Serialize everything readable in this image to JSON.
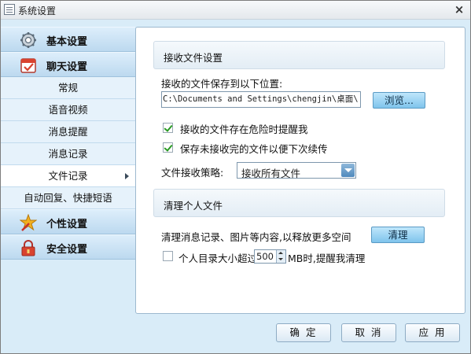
{
  "window": {
    "title": "系统设置",
    "close_glyph": "×"
  },
  "sidebar": {
    "main_items": [
      {
        "label": "基本设置",
        "icon": "gear-icon"
      },
      {
        "label": "聊天设置",
        "icon": "calendar-check-icon"
      },
      {
        "label": "个性设置",
        "icon": "star-brush-icon"
      },
      {
        "label": "安全设置",
        "icon": "lock-icon"
      }
    ],
    "sub_items": [
      {
        "label": "常规"
      },
      {
        "label": "语音视频"
      },
      {
        "label": "消息提醒"
      },
      {
        "label": "消息记录"
      },
      {
        "label": "文件记录",
        "selected": true
      },
      {
        "label": "自动回复、快捷短语"
      }
    ]
  },
  "receive_section": {
    "title": "接收文件设置",
    "save_location_label": "接收的文件保存到以下位置:",
    "save_path": "C:\\Documents and Settings\\chengjin\\桌面\\",
    "browse_button": "浏览...",
    "checkbox_danger": {
      "label": "接收的文件存在危险时提醒我",
      "checked": true
    },
    "checkbox_resume": {
      "label": "保存未接收完的文件以便下次续传",
      "checked": true
    },
    "strategy_label": "文件接收策略:",
    "strategy_value": "接收所有文件"
  },
  "cleanup_section": {
    "title": "清理个人文件",
    "description": "清理消息记录、图片等内容,以释放更多空间",
    "clean_button": "清理",
    "limit_checkbox": {
      "checked": false,
      "prefix": "个人目录大小超过",
      "value": "500",
      "suffix": "MB时,提醒我清理"
    }
  },
  "footer": {
    "ok": "确 定",
    "cancel": "取 消",
    "apply": "应 用"
  },
  "colors": {
    "window_bg": "#d9ecf8",
    "accent_button": "#7fc4ec",
    "check_green": "#2a9a24"
  }
}
